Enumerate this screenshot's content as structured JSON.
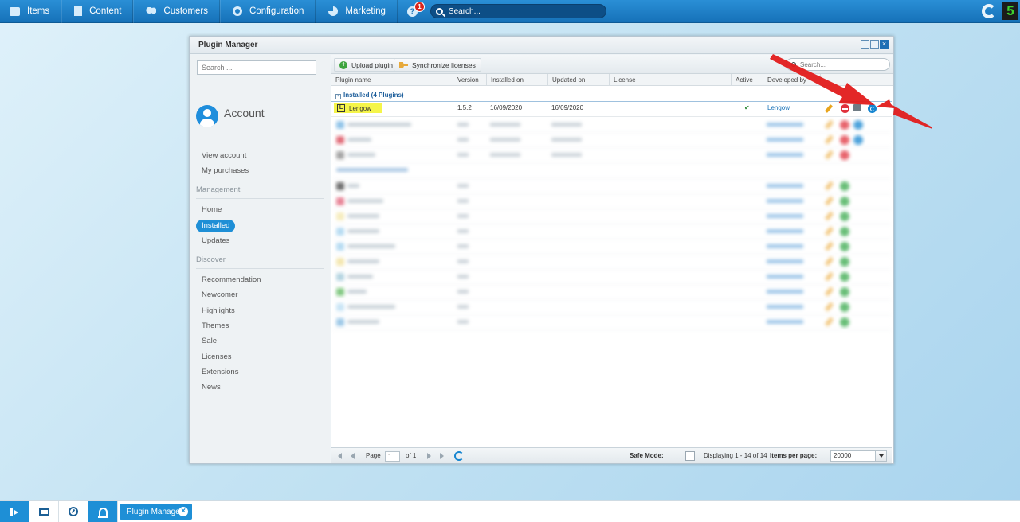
{
  "topbar": {
    "items": [
      {
        "label": "Items",
        "icon": "items-icon"
      },
      {
        "label": "Content",
        "icon": "content-icon"
      },
      {
        "label": "Customers",
        "icon": "customers-icon"
      },
      {
        "label": "Configuration",
        "icon": "gear-icon"
      },
      {
        "label": "Marketing",
        "icon": "marketing-icon"
      }
    ],
    "help_glyph": "?",
    "notification_count": "1",
    "search_placeholder": "Search..."
  },
  "window": {
    "title": "Plugin Manager",
    "close_glyph": "×"
  },
  "sidebar": {
    "search_placeholder": "Search ...",
    "account_title": "Account",
    "account_links": [
      "View account",
      "My purchases"
    ],
    "management_label": "Management",
    "management_links": [
      "Home",
      "Installed",
      "Updates"
    ],
    "discover_label": "Discover",
    "discover_links": [
      "Recommendation",
      "Newcomer",
      "Highlights",
      "Themes",
      "Sale",
      "Licenses",
      "Extensions",
      "News"
    ]
  },
  "toolbar": {
    "upload_label": "Upload plugin",
    "sync_label": "Synchronize licenses",
    "search_placeholder": "Search..."
  },
  "grid": {
    "columns": [
      "Plugin name",
      "Version",
      "Installed on",
      "Updated on",
      "License",
      "Active",
      "Developed by"
    ],
    "group_installed": "Installed (4 Plugins)",
    "rows": [
      {
        "name": "Lengow",
        "logo_letter": "L",
        "version": "1.5.2",
        "installed_on": "16/09/2020",
        "updated_on": "16/09/2020",
        "license": "",
        "active": "✔",
        "developer": "Lengow"
      }
    ]
  },
  "pager": {
    "page_label": "Page",
    "page_value": "1",
    "of_label": "of 1",
    "safe_mode_label": "Safe Mode:",
    "displaying": "Displaying 1 - 14 of 14",
    "items_per_page_label": "Items per page:",
    "items_per_page_value": "20000"
  },
  "taskbar": {
    "open_window": "Plugin Manager",
    "close_glyph": "×"
  },
  "colors": {
    "accent": "#1e8fd6",
    "highlight": "#f5f54a",
    "annotation_arrow": "#e11b1b"
  }
}
